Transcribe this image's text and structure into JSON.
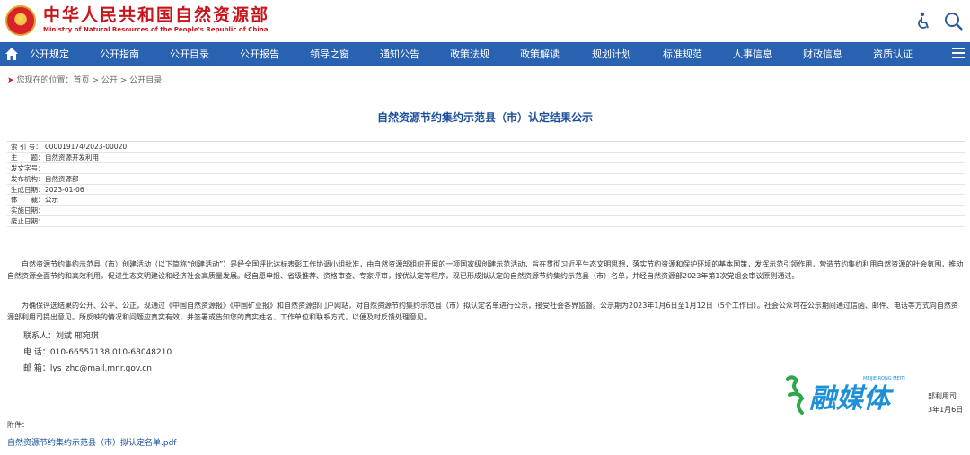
{
  "header": {
    "title": "中华人民共和国自然资源部",
    "subtitle": "Ministry of Natural Resources of the People's Republic of China"
  },
  "nav": {
    "items": [
      "公开规定",
      "公开指南",
      "公开目录",
      "公开报告",
      "领导之窗",
      "通知公告",
      "政策法规",
      "政策解读",
      "规划计划",
      "标准规范",
      "人事信息",
      "财政信息",
      "资质认证"
    ]
  },
  "breadcrumb": {
    "prefix": "您现在的位置：",
    "items": [
      "首页",
      "公开",
      "公开目录"
    ],
    "separator": ">"
  },
  "document": {
    "title": "自然资源节约集约示范县（市）认定结果公示",
    "meta": [
      {
        "label": "索 引 号：",
        "value": "000019174/2023-00020"
      },
      {
        "label": "主　　题：",
        "value": "自然资源开发利用"
      },
      {
        "label": "发文字号：",
        "value": ""
      },
      {
        "label": "发布机构：",
        "value": "自然资源部"
      },
      {
        "label": "生成日期：",
        "value": "2023-01-06"
      },
      {
        "label": "体　　裁：",
        "value": "公示"
      },
      {
        "label": "实施日期：",
        "value": ""
      },
      {
        "label": "废止日期：",
        "value": ""
      }
    ],
    "paragraph1": "自然资源节约集约示范县（市）创建活动（以下简称“创建活动”）是经全国评比达标表彰工作协调小组批准，由自然资源部组织开展的一项国家级创建示范活动，旨在贯彻习近平生态文明思想，落实节约资源和保护环境的基本国策，发挥示范引领作用，营造节约集约利用自然资源的社会氛围，推动自然资源全面节约和高效利用，促进生态文明建设和经济社会高质量发展。经自愿申报、省级推荐、资格审查、专家评审，按优认定等程序，现已形成拟认定的自然资源节约集约示范县（市）名单，并经自然资源部2023年第1次党组会审议原则通过。",
    "paragraph2": "为确保评选结果的公开、公平、公正，现通过《中国自然资源报》《中国矿业报》和自然资源部门户网站，对自然资源节约集约示范县（市）拟认定名单进行公示，接受社会各界监督。公示期为2023年1月6日至1月12日（5个工作日）。社会公众可在公示期间通过信函、邮件、电话等方式向自然资源部利用司提出意见。所反映的情况和问题应真实有效，并签署或告知您的真实姓名、工作单位和联系方式，以便及时反馈处理意见。",
    "contact": {
      "person": "联系人：刘斌  邢宛琪",
      "phone": "电  话：010-66557138   010-68048210",
      "email": "邮  箱：lys_zhc@mail.mnr.gov.cn"
    },
    "attachment_label": "附件：",
    "attachment_link": "自然资源节约集约示范县（市）拟认定名单.pdf"
  },
  "watermark": {
    "logo_text": "融媒体",
    "small_text": "MEIJIE RONG MEITI",
    "note1": "部利用司",
    "note2": "3年1月6日"
  },
  "colors": {
    "brand_red": "#c8161d",
    "nav_blue": "#2a62b2",
    "title_blue": "#1a4f9c"
  }
}
